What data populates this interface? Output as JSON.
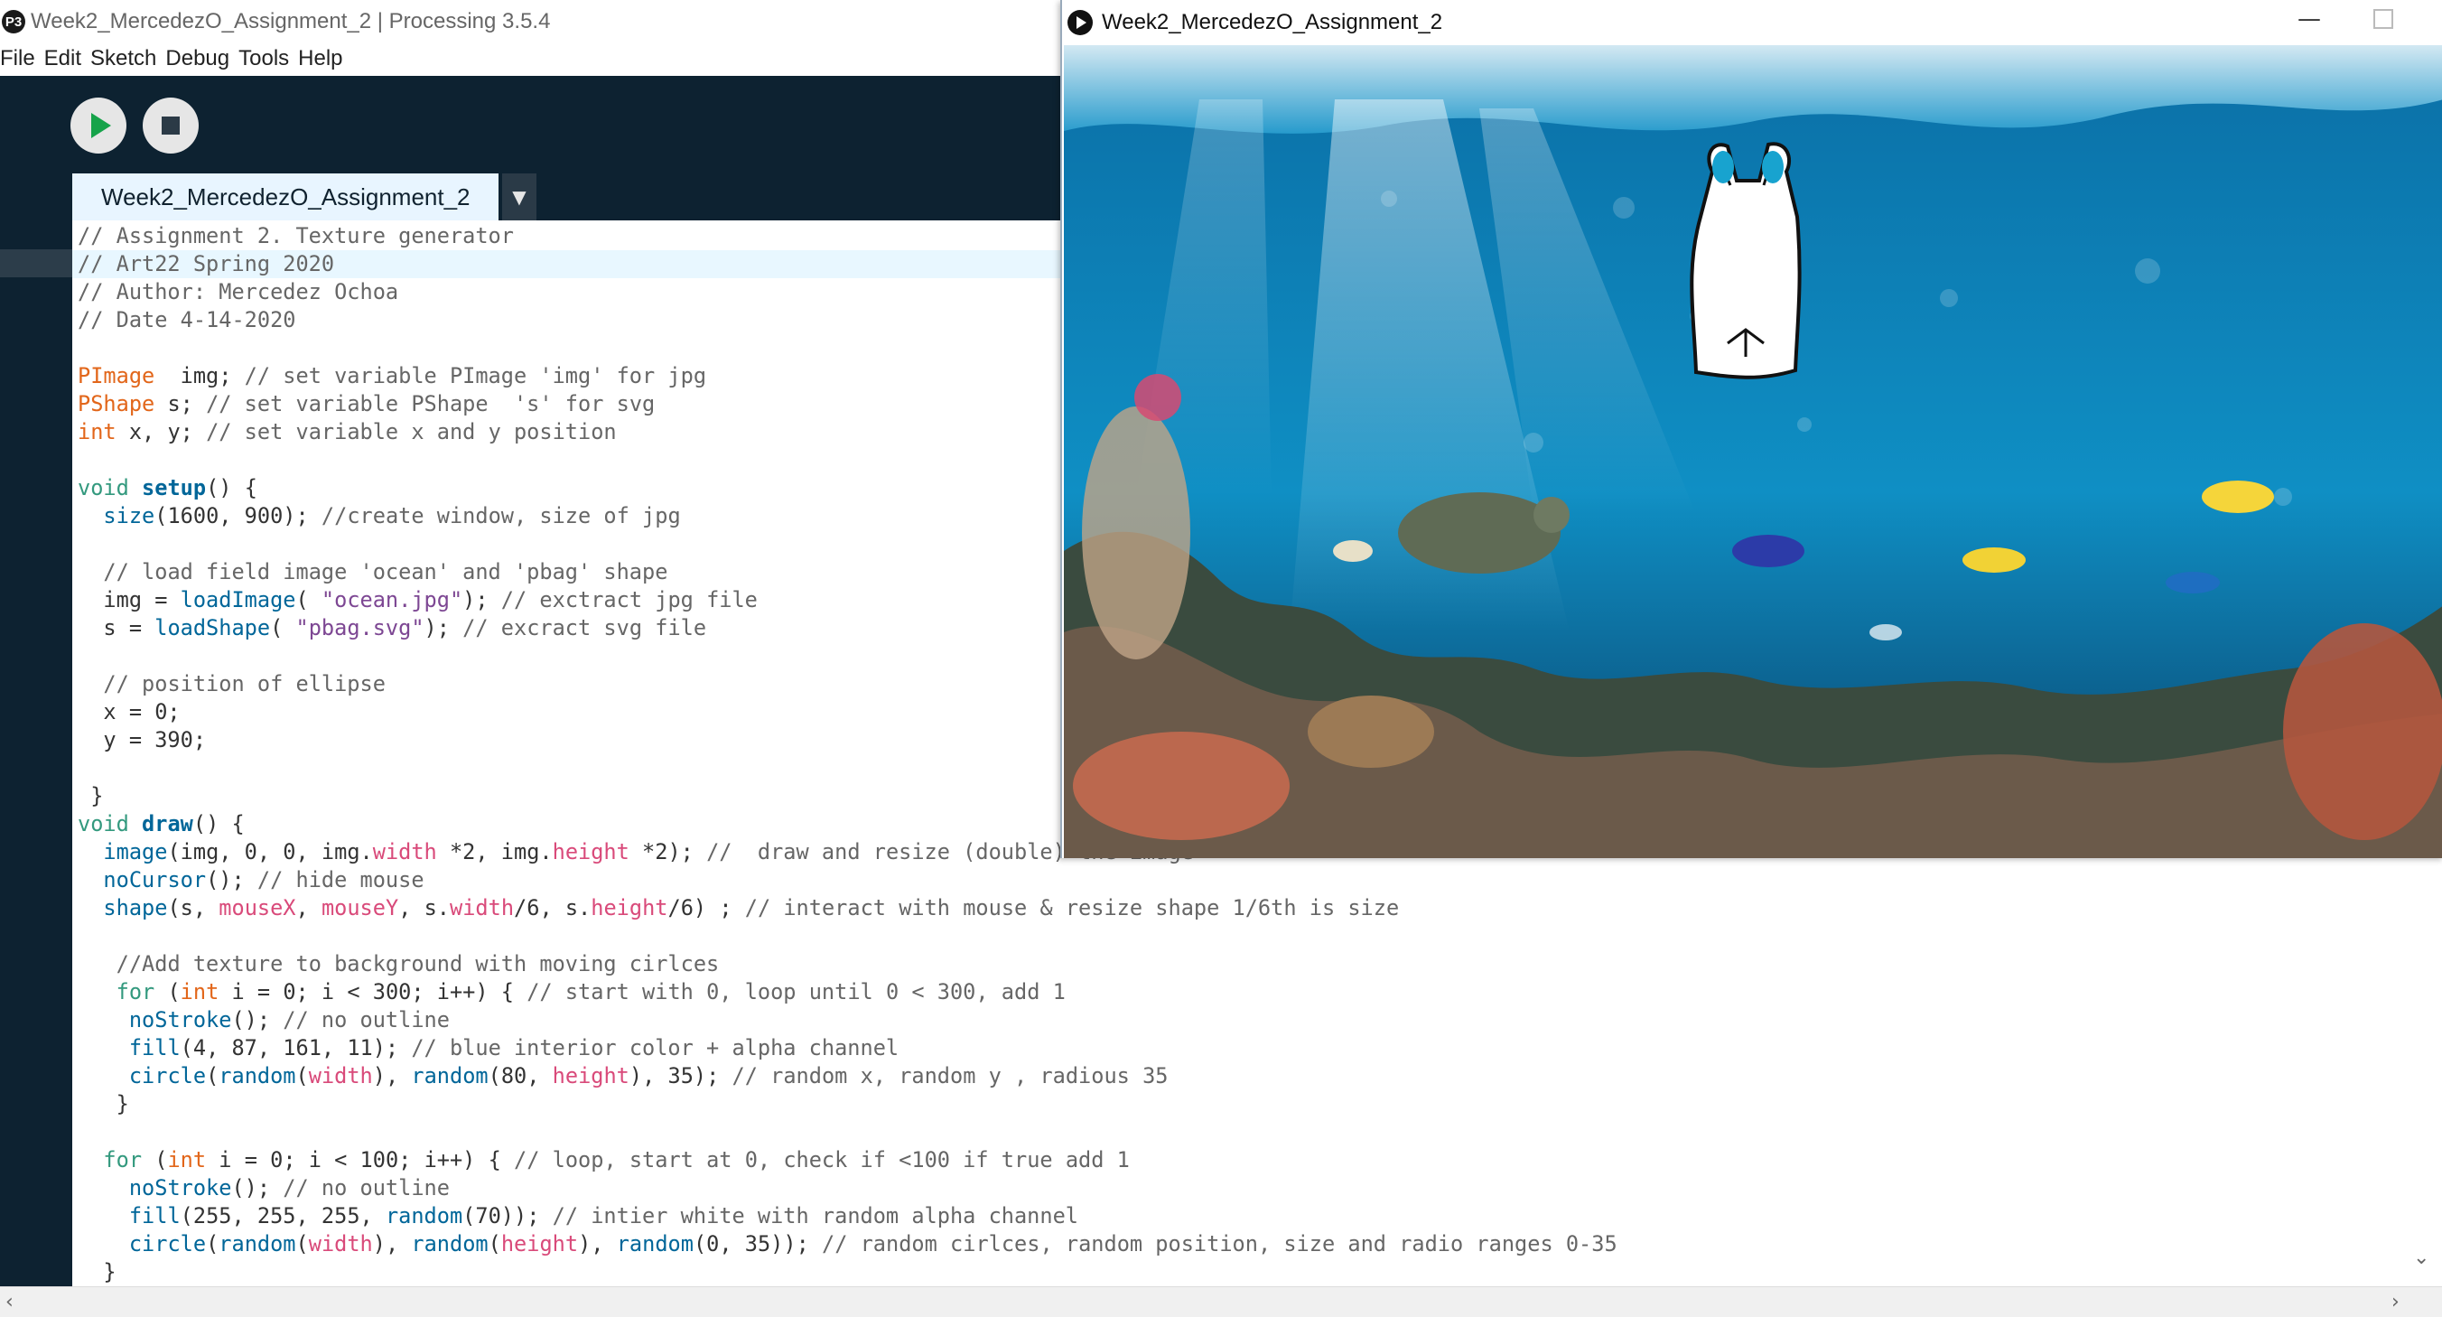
{
  "ide": {
    "title": "Week2_MercedezO_Assignment_2 | Processing 3.5.4",
    "logo_glyph": "P3",
    "menu": [
      "File",
      "Edit",
      "Sketch",
      "Debug",
      "Tools",
      "Help"
    ],
    "tab_label": "Week2_MercedezO_Assignment_2",
    "tab_menu_glyph": "▼",
    "current_line": 2
  },
  "code_lines": [
    {
      "n": "1",
      "segs": [
        [
          "cm",
          "// Assignment 2. Texture generator"
        ]
      ]
    },
    {
      "n": "2",
      "segs": [
        [
          "cm",
          "// Art22 Spring 2020"
        ]
      ]
    },
    {
      "n": "3",
      "segs": [
        [
          "cm",
          "// Author: Mercedez Ochoa"
        ]
      ]
    },
    {
      "n": "4",
      "segs": [
        [
          "cm",
          "// Date 4-14-2020"
        ]
      ]
    },
    {
      "n": "5",
      "segs": []
    },
    {
      "n": "6",
      "segs": [
        [
          "ty",
          "PImage"
        ],
        [
          "",
          "  img; "
        ],
        [
          "cm",
          "// set variable PImage 'img' for jpg"
        ]
      ]
    },
    {
      "n": "7",
      "segs": [
        [
          "ty",
          "PShape"
        ],
        [
          "",
          " s; "
        ],
        [
          "cm",
          "// set variable PShape  's' for svg"
        ]
      ]
    },
    {
      "n": "8",
      "segs": [
        [
          "ty",
          "int"
        ],
        [
          "",
          " x, y; "
        ],
        [
          "cm",
          "// set variable x and y position"
        ]
      ]
    },
    {
      "n": "9",
      "segs": []
    },
    {
      "n": "10",
      "segs": [
        [
          "kw",
          "void"
        ],
        [
          "",
          " "
        ],
        [
          "fnb",
          "setup"
        ],
        [
          "",
          "() {"
        ]
      ]
    },
    {
      "n": "11",
      "segs": [
        [
          "",
          "  "
        ],
        [
          "fn",
          "size"
        ],
        [
          "",
          "(1600, 900); "
        ],
        [
          "cm",
          "//create window, size of jpg"
        ]
      ]
    },
    {
      "n": "12",
      "segs": []
    },
    {
      "n": "13",
      "segs": [
        [
          "",
          "  "
        ],
        [
          "cm",
          "// load field image 'ocean' and 'pbag' shape"
        ]
      ]
    },
    {
      "n": "14",
      "segs": [
        [
          "",
          "  img = "
        ],
        [
          "fn",
          "loadImage"
        ],
        [
          "",
          "( "
        ],
        [
          "st",
          "\"ocean.jpg\""
        ],
        [
          "",
          "); "
        ],
        [
          "cm",
          "// exctract jpg file"
        ]
      ]
    },
    {
      "n": "15",
      "segs": [
        [
          "",
          "  s = "
        ],
        [
          "fn",
          "loadShape"
        ],
        [
          "",
          "( "
        ],
        [
          "st",
          "\"pbag.svg\""
        ],
        [
          "",
          "); "
        ],
        [
          "cm",
          "// excract svg file"
        ]
      ]
    },
    {
      "n": "16",
      "segs": []
    },
    {
      "n": "17",
      "segs": [
        [
          "",
          "  "
        ],
        [
          "cm",
          "// position of ellipse"
        ]
      ]
    },
    {
      "n": "18",
      "segs": [
        [
          "",
          "  x = 0;"
        ]
      ]
    },
    {
      "n": "19",
      "segs": [
        [
          "",
          "  y = 390;"
        ]
      ]
    },
    {
      "n": "20",
      "segs": []
    },
    {
      "n": "21",
      "segs": [
        [
          "",
          " }"
        ]
      ]
    },
    {
      "n": "22",
      "segs": [
        [
          "kw",
          "void"
        ],
        [
          "",
          " "
        ],
        [
          "fnb",
          "draw"
        ],
        [
          "",
          "() {"
        ]
      ]
    },
    {
      "n": "23",
      "segs": [
        [
          "",
          "  "
        ],
        [
          "fn",
          "image"
        ],
        [
          "",
          "(img, 0, 0, img."
        ],
        [
          "vr",
          "width"
        ],
        [
          "",
          " *2, img."
        ],
        [
          "vr",
          "height"
        ],
        [
          "",
          " *2); "
        ],
        [
          "cm",
          "//  draw and resize (double) the image"
        ]
      ]
    },
    {
      "n": "24",
      "segs": [
        [
          "",
          "  "
        ],
        [
          "fn",
          "noCursor"
        ],
        [
          "",
          "(); "
        ],
        [
          "cm",
          "// hide mouse"
        ]
      ]
    },
    {
      "n": "25",
      "segs": [
        [
          "",
          "  "
        ],
        [
          "fn",
          "shape"
        ],
        [
          "",
          "(s, "
        ],
        [
          "vr",
          "mouseX"
        ],
        [
          "",
          ", "
        ],
        [
          "vr",
          "mouseY"
        ],
        [
          "",
          ", s."
        ],
        [
          "vr",
          "width"
        ],
        [
          "",
          "/6, s."
        ],
        [
          "vr",
          "height"
        ],
        [
          "",
          "/6) ; "
        ],
        [
          "cm",
          "// interact with mouse & resize shape 1/6th is size"
        ]
      ]
    },
    {
      "n": "26",
      "segs": []
    },
    {
      "n": "27",
      "segs": [
        [
          "",
          "   "
        ],
        [
          "cm",
          "//Add texture to background with moving cirlces"
        ]
      ]
    },
    {
      "n": "28",
      "segs": [
        [
          "",
          "   "
        ],
        [
          "kw",
          "for"
        ],
        [
          "",
          " ("
        ],
        [
          "ty",
          "int"
        ],
        [
          "",
          " i = 0; i < 300; i++) { "
        ],
        [
          "cm",
          "// start with 0, loop until 0 < 300, add 1"
        ]
      ]
    },
    {
      "n": "29",
      "segs": [
        [
          "",
          "    "
        ],
        [
          "fn",
          "noStroke"
        ],
        [
          "",
          "(); "
        ],
        [
          "cm",
          "// no outline"
        ]
      ]
    },
    {
      "n": "30",
      "segs": [
        [
          "",
          "    "
        ],
        [
          "fn",
          "fill"
        ],
        [
          "",
          "(4, 87, 161, 11); "
        ],
        [
          "cm",
          "// blue interior color + alpha channel"
        ]
      ]
    },
    {
      "n": "31",
      "segs": [
        [
          "",
          "    "
        ],
        [
          "fn",
          "circle"
        ],
        [
          "",
          "("
        ],
        [
          "fn",
          "random"
        ],
        [
          "",
          "("
        ],
        [
          "vr",
          "width"
        ],
        [
          "",
          "), "
        ],
        [
          "fn",
          "random"
        ],
        [
          "",
          "(80, "
        ],
        [
          "vr",
          "height"
        ],
        [
          "",
          "), 35); "
        ],
        [
          "cm",
          "// random x, random y , radious 35"
        ]
      ]
    },
    {
      "n": "32",
      "segs": [
        [
          "",
          "   }"
        ]
      ]
    },
    {
      "n": "33",
      "segs": []
    },
    {
      "n": "34",
      "segs": [
        [
          "",
          "  "
        ],
        [
          "kw",
          "for"
        ],
        [
          "",
          " ("
        ],
        [
          "ty",
          "int"
        ],
        [
          "",
          " i = 0; i < 100; i++) { "
        ],
        [
          "cm",
          "// loop, start at 0, check if <100 if true add 1"
        ]
      ]
    },
    {
      "n": "35",
      "segs": [
        [
          "",
          "    "
        ],
        [
          "fn",
          "noStroke"
        ],
        [
          "",
          "(); "
        ],
        [
          "cm",
          "// no outline"
        ]
      ]
    },
    {
      "n": "36",
      "segs": [
        [
          "",
          "    "
        ],
        [
          "fn",
          "fill"
        ],
        [
          "",
          "(255, 255, 255, "
        ],
        [
          "fn",
          "random"
        ],
        [
          "",
          "(70)); "
        ],
        [
          "cm",
          "// intier white with random alpha channel"
        ]
      ]
    },
    {
      "n": "37",
      "segs": [
        [
          "",
          "    "
        ],
        [
          "fn",
          "circle"
        ],
        [
          "",
          "("
        ],
        [
          "fn",
          "random"
        ],
        [
          "",
          "("
        ],
        [
          "vr",
          "width"
        ],
        [
          "",
          "), "
        ],
        [
          "fn",
          "random"
        ],
        [
          "",
          "("
        ],
        [
          "vr",
          "height"
        ],
        [
          "",
          "), "
        ],
        [
          "fn",
          "random"
        ],
        [
          "",
          "(0, 35)); "
        ],
        [
          "cm",
          "// random cirlces, random position, size and radio ranges 0-35"
        ]
      ]
    },
    {
      "n": "38",
      "segs": [
        [
          "",
          "  }"
        ]
      ]
    }
  ],
  "sketch_window": {
    "title": "Week2_MercedezO_Assignment_2",
    "minimize_glyph": "—",
    "water_top_color": "#0b6fa6",
    "water_bottom_color": "#0a3e66",
    "ellipse_color": "#d64a72"
  },
  "scroll": {
    "left_arrow": "‹",
    "right_arrow": "›",
    "down_arrow": "⌄"
  }
}
